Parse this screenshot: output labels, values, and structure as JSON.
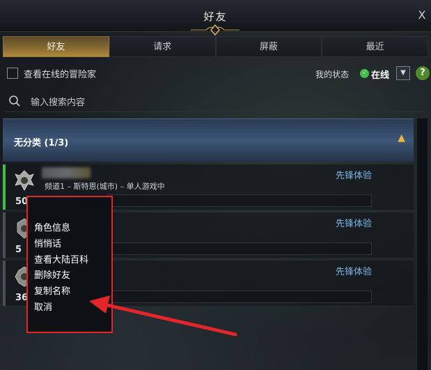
{
  "window": {
    "title": "好友",
    "close_label": "X"
  },
  "tabs": [
    {
      "label": "好友",
      "active": true
    },
    {
      "label": "请求",
      "active": false
    },
    {
      "label": "屏蔽",
      "active": false
    },
    {
      "label": "最近",
      "active": false
    }
  ],
  "toolbar": {
    "show_online_label": "查看在线的冒险家",
    "show_online_checked": false,
    "my_status_label": "我的状态",
    "status_value": "在线",
    "dropdown_icon": "chevron-down-icon",
    "help_label": "?"
  },
  "search": {
    "placeholder": "输入搜索内容",
    "value": ""
  },
  "group": {
    "title": "无分类 (1/3)",
    "toggle_icon": "chevron-up-icon"
  },
  "friends": [
    {
      "level": "50",
      "location": "频道1 – 斯特恩(城市) – 单人游戏中",
      "server": "先锋体验",
      "online": true
    },
    {
      "level": "5",
      "location": "",
      "server": "先锋体验",
      "online": false
    },
    {
      "level": "36",
      "location": "",
      "server": "先锋体验",
      "online": false
    }
  ],
  "context_menu": {
    "items": [
      "角色信息",
      "悄悄话",
      "查看大陆百科",
      "删除好友",
      "复制名称",
      "取消"
    ]
  },
  "colors": {
    "accent_gold": "#b18b3c",
    "online_green": "#3fbf4a",
    "server_blue": "#79b7e8",
    "annotation_red": "#e3262a"
  }
}
